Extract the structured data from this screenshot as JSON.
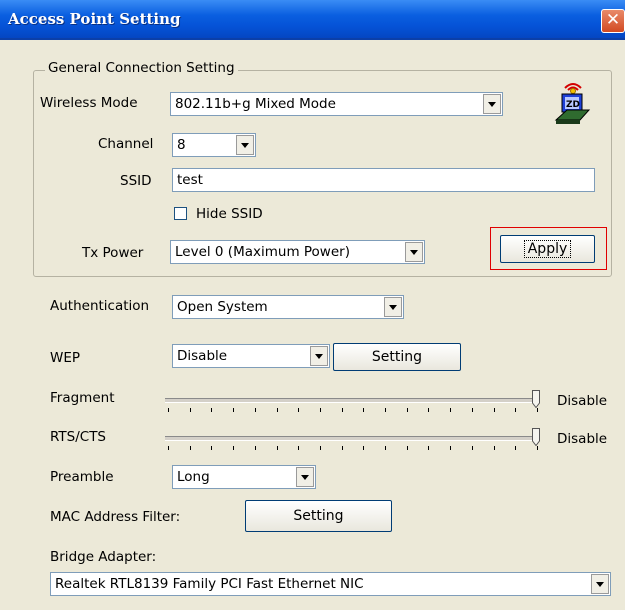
{
  "window": {
    "title": "Access Point Setting",
    "close_glyph": "✕"
  },
  "general": {
    "group_label": "General Connection Setting",
    "wireless_mode": {
      "label": "Wireless Mode",
      "value": "802.11b+g Mixed Mode"
    },
    "channel": {
      "label": "Channel",
      "value": "8"
    },
    "ssid": {
      "label": "SSID",
      "value": "test"
    },
    "hide_ssid": {
      "label": "Hide SSID",
      "checked": false
    },
    "tx_power": {
      "label": "Tx Power",
      "value": "Level 0 (Maximum Power)"
    },
    "apply_label": "Apply",
    "icon": "wireless-access-point-icon"
  },
  "authentication": {
    "label": "Authentication",
    "value": "Open System"
  },
  "wep": {
    "label": "WEP",
    "value": "Disable",
    "setting_label": "Setting"
  },
  "fragment": {
    "label": "Fragment",
    "value_label": "Disable",
    "level": 1.0
  },
  "rts_cts": {
    "label": "RTS/CTS",
    "value_label": "Disable",
    "level": 1.0
  },
  "preamble": {
    "label": "Preamble",
    "value": "Long"
  },
  "mac_filter": {
    "label": "MAC Address Filter:",
    "setting_label": "Setting"
  },
  "bridge": {
    "label": "Bridge Adapter:",
    "value": "Realtek RTL8139 Family PCI Fast Ethernet NIC"
  },
  "colors": {
    "titlebar": "#0552d6",
    "dialog_bg": "#ece9d8",
    "highlight": "#e00000"
  }
}
